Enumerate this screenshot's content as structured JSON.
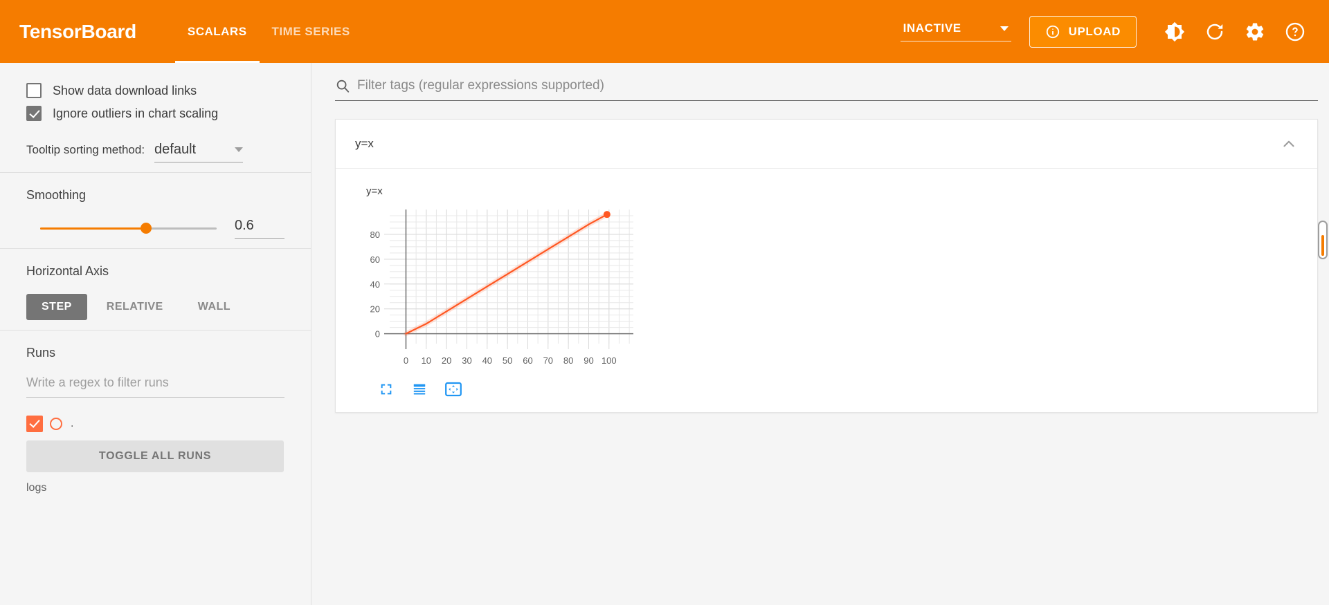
{
  "header": {
    "brand": "TensorBoard",
    "tabs": [
      {
        "label": "SCALARS",
        "active": true
      },
      {
        "label": "TIME SERIES",
        "active": false
      }
    ],
    "run_selector_value": "INACTIVE",
    "upload_label": "UPLOAD",
    "icons": [
      "info-icon",
      "brightness-icon",
      "refresh-icon",
      "settings-gear-icon",
      "help-icon"
    ],
    "accent_color": "#f57c00"
  },
  "sidebar": {
    "checkboxes": [
      {
        "label": "Show data download links",
        "checked": false
      },
      {
        "label": "Ignore outliers in chart scaling",
        "checked": true
      }
    ],
    "tooltip": {
      "label": "Tooltip sorting method:",
      "value": "default"
    },
    "smoothing": {
      "title": "Smoothing",
      "value": "0.6",
      "percent": 60
    },
    "horizontal_axis": {
      "title": "Horizontal Axis",
      "options": [
        {
          "label": "STEP",
          "active": true
        },
        {
          "label": "RELATIVE",
          "active": false
        },
        {
          "label": "WALL",
          "active": false
        }
      ]
    },
    "runs": {
      "title": "Runs",
      "filter_placeholder": "Write a regex to filter runs",
      "run_items": [
        {
          "label": ".",
          "checked": true,
          "color": "#ff6e40"
        }
      ],
      "toggle_all_label": "TOGGLE ALL RUNS",
      "logs_label": "logs"
    }
  },
  "main": {
    "filter_placeholder": "Filter tags (regular expressions supported)",
    "card": {
      "title": "y=x",
      "collapse_icon": "chevron-up-icon",
      "tools": [
        "fullscreen-icon",
        "data-table-icon",
        "fit-domain-icon"
      ]
    }
  },
  "chart_data": {
    "type": "line",
    "title": "y=x",
    "xlabel": "",
    "ylabel": "",
    "xlim": [
      -8,
      112
    ],
    "ylim": [
      -8,
      100
    ],
    "xticks": [
      0,
      10,
      20,
      30,
      40,
      50,
      60,
      70,
      80,
      90,
      100
    ],
    "yticks": [
      0,
      20,
      40,
      60,
      80
    ],
    "grid": true,
    "legend": "none",
    "series": [
      {
        "name": "y=x",
        "color": "#ff5722",
        "x": [
          0,
          10,
          20,
          30,
          40,
          50,
          60,
          70,
          80,
          90,
          99
        ],
        "values": [
          0,
          8,
          18,
          28,
          38,
          48,
          58,
          68,
          78,
          88,
          96
        ],
        "endpoint_marker": {
          "x": 99,
          "y": 96
        }
      }
    ]
  }
}
